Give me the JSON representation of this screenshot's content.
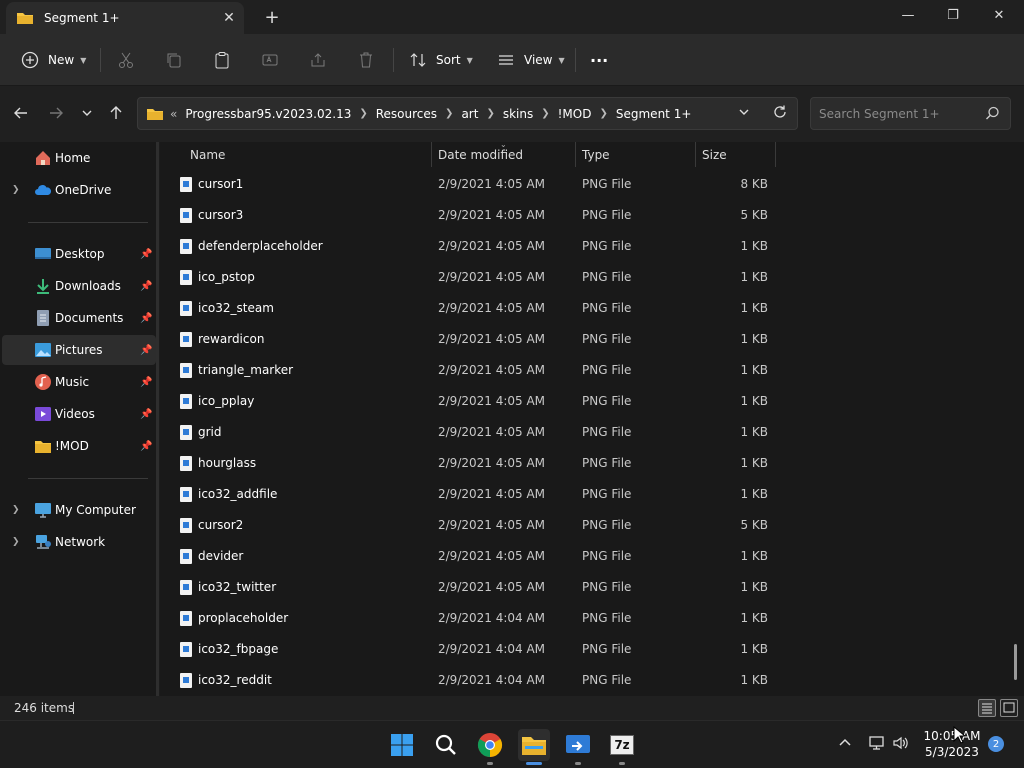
{
  "window": {
    "tab_title": "Segment 1+",
    "close_tab": "✕",
    "new_tab": "+",
    "minimize": "—",
    "maximize": "❐",
    "close": "✕"
  },
  "toolbar": {
    "new_label": "New",
    "sort_label": "Sort",
    "view_label": "View",
    "more_label": "···"
  },
  "address": {
    "overflow": "«",
    "crumbs": [
      "Progressbar95.v2023.02.13",
      "Resources",
      "art",
      "skins",
      "!MOD",
      "Segment 1+"
    ],
    "search_placeholder": "Search Segment 1+"
  },
  "sidebar": {
    "items": [
      {
        "label": "Home",
        "icon": "home-icon"
      },
      {
        "label": "OneDrive",
        "icon": "cloud-icon"
      },
      {
        "label": "Desktop",
        "icon": "desktop-icon"
      },
      {
        "label": "Downloads",
        "icon": "download-icon"
      },
      {
        "label": "Documents",
        "icon": "document-icon"
      },
      {
        "label": "Pictures",
        "icon": "picture-icon"
      },
      {
        "label": "Music",
        "icon": "music-icon"
      },
      {
        "label": "Videos",
        "icon": "video-icon"
      },
      {
        "label": "!MOD",
        "icon": "folder-icon"
      },
      {
        "label": "My Computer",
        "icon": "computer-icon"
      },
      {
        "label": "Network",
        "icon": "network-icon"
      }
    ]
  },
  "columns": {
    "name": "Name",
    "date": "Date modified",
    "type": "Type",
    "size": "Size"
  },
  "files": [
    {
      "name": "cursor1",
      "date": "2/9/2021 4:05 AM",
      "type": "PNG File",
      "size": "8 KB"
    },
    {
      "name": "cursor3",
      "date": "2/9/2021 4:05 AM",
      "type": "PNG File",
      "size": "5 KB"
    },
    {
      "name": "defenderplaceholder",
      "date": "2/9/2021 4:05 AM",
      "type": "PNG File",
      "size": "1 KB"
    },
    {
      "name": "ico_pstop",
      "date": "2/9/2021 4:05 AM",
      "type": "PNG File",
      "size": "1 KB"
    },
    {
      "name": "ico32_steam",
      "date": "2/9/2021 4:05 AM",
      "type": "PNG File",
      "size": "1 KB"
    },
    {
      "name": "rewardicon",
      "date": "2/9/2021 4:05 AM",
      "type": "PNG File",
      "size": "1 KB"
    },
    {
      "name": "triangle_marker",
      "date": "2/9/2021 4:05 AM",
      "type": "PNG File",
      "size": "1 KB"
    },
    {
      "name": "ico_pplay",
      "date": "2/9/2021 4:05 AM",
      "type": "PNG File",
      "size": "1 KB"
    },
    {
      "name": "grid",
      "date": "2/9/2021 4:05 AM",
      "type": "PNG File",
      "size": "1 KB"
    },
    {
      "name": "hourglass",
      "date": "2/9/2021 4:05 AM",
      "type": "PNG File",
      "size": "1 KB"
    },
    {
      "name": "ico32_addfile",
      "date": "2/9/2021 4:05 AM",
      "type": "PNG File",
      "size": "1 KB"
    },
    {
      "name": "cursor2",
      "date": "2/9/2021 4:05 AM",
      "type": "PNG File",
      "size": "5 KB"
    },
    {
      "name": "devider",
      "date": "2/9/2021 4:05 AM",
      "type": "PNG File",
      "size": "1 KB"
    },
    {
      "name": "ico32_twitter",
      "date": "2/9/2021 4:05 AM",
      "type": "PNG File",
      "size": "1 KB"
    },
    {
      "name": "proplaceholder",
      "date": "2/9/2021 4:04 AM",
      "type": "PNG File",
      "size": "1 KB"
    },
    {
      "name": "ico32_fbpage",
      "date": "2/9/2021 4:04 AM",
      "type": "PNG File",
      "size": "1 KB"
    },
    {
      "name": "ico32_reddit",
      "date": "2/9/2021 4:04 AM",
      "type": "PNG File",
      "size": "1 KB"
    }
  ],
  "status": {
    "item_count": "246 items"
  },
  "taskbar": {
    "apps": [
      "windows-start-icon",
      "search-icon",
      "chrome-icon",
      "file-explorer-icon",
      "remote-desktop-icon",
      "7zip-icon"
    ],
    "zip_label": "7z",
    "time": "10:05 AM",
    "date": "5/3/2023",
    "notifications": "2"
  },
  "colors": {
    "accent": "#4a8fe0",
    "folder": "#f5c542",
    "background": "#191919"
  }
}
